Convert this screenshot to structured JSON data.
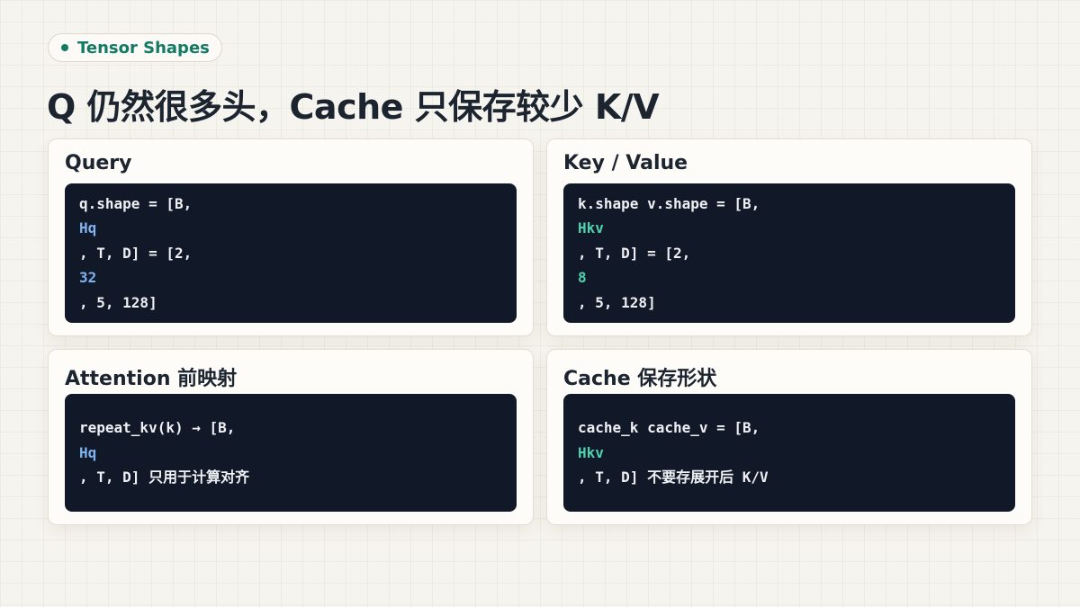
{
  "badge": {
    "label": "Tensor Shapes"
  },
  "title": "Q 仍然很多头，Cache 只保存较少 K/V",
  "colors": {
    "accent": "#137a63",
    "query_highlight": "#7fb2f0",
    "kv_highlight": "#4fd1b0",
    "code_bg": "#111827"
  },
  "cards": [
    {
      "title": "Query",
      "lines": [
        "q.shape = [B,",
        "Hq",
        ", T, D] = [2,",
        "32",
        ", 5, 128]"
      ]
    },
    {
      "title": "Key / Value",
      "lines": [
        "k.shape v.shape = [B,",
        "Hkv",
        ", T, D] = [2,",
        "8",
        ", 5, 128]"
      ]
    },
    {
      "title": "Attention 前映射",
      "lines": [
        "repeat_kv(k) → [B,",
        "Hq",
        ", T, D] 只用于计算对齐"
      ]
    },
    {
      "title": "Cache 保存形状",
      "lines": [
        "cache_k cache_v = [B,",
        "Hkv",
        ", T, D] 不要存展开后 K/V"
      ]
    }
  ]
}
